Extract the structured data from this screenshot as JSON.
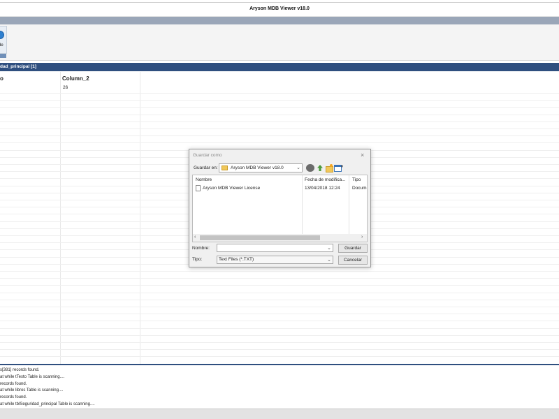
{
  "window": {
    "title": "Aryson MDB Viewer v18.0"
  },
  "ribbon": {
    "partial_button_label": "de"
  },
  "tab": {
    "label": "dad_principal [1]"
  },
  "grid": {
    "columns": [
      "o",
      "Column_2"
    ],
    "rows": [
      [
        "",
        "26"
      ]
    ]
  },
  "log": {
    "lines": [
      "s[381] records found.",
      "at while tTexto Table is scanning....",
      "records found.",
      "at while libros Table is scanning....",
      "records found.",
      "at while tblSeguridad_principal Table is scanning...."
    ]
  },
  "dialog": {
    "title": "Guardar como",
    "close_glyph": "×",
    "save_in_label": "Guardar en:",
    "save_in_value": "Aryson MDB Viewer v18.0",
    "columns": {
      "name": "Nombre",
      "date": "Fecha de modifica...",
      "type": "Tipo"
    },
    "files": [
      {
        "name": "Aryson MDB Viewer License",
        "date": "13/04/2018 12:24",
        "type": "Docume"
      }
    ],
    "filename_label": "Nombre:",
    "filename_value": "",
    "filetype_label": "Tipo:",
    "filetype_value": "Text Files (*.TXT)",
    "save_button": "Guardar",
    "cancel_button": "Cancelar"
  }
}
